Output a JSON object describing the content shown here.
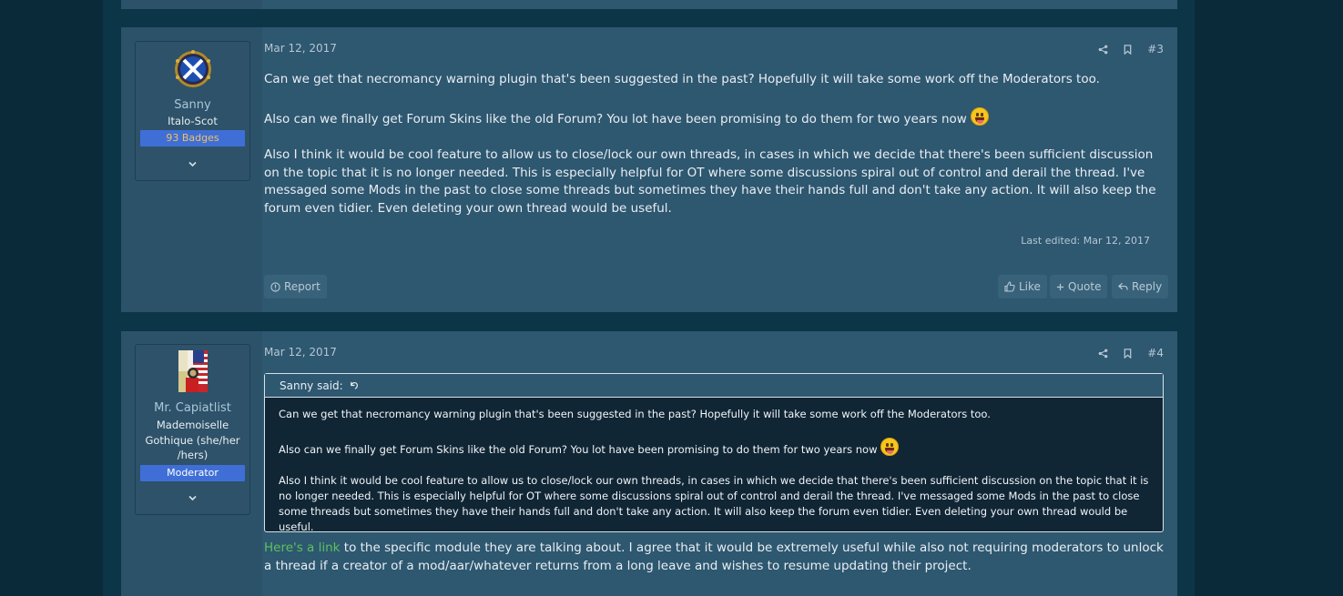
{
  "posts": [
    {
      "user": {
        "name": "Sanny",
        "title": "Italo-Scot",
        "badge": "93 Badges",
        "badge_color": "#3f6fd6",
        "badge_text_color": "#f0c060",
        "expand_icon": "chevron-down-icon",
        "avatar": "saltire-crest-avatar"
      },
      "date": "Mar 12, 2017",
      "post_number": "#3",
      "paragraphs": [
        "Can we get that necromancy warning plugin that's been suggested in the past? Hopefully it will take some work off the Moderators too.",
        "Also can we finally get Forum Skins like the old Forum? You lot have been promising to do them for two years now",
        "Also I think it would be cool feature to allow us to close/lock our own threads, in cases in which we decide that there's been sufficient discussion on the topic that it is no longer needed. This is especially helpful for OT where some discussions spiral out of control and derail the thread. I've messaged some Mods in the past to close some threads but sometimes they have their hands full and don't take any action. It will also keep the forum even tidier. Even deleting your own thread would be useful."
      ],
      "last_edited": "Last edited: Mar 12, 2017",
      "buttons": {
        "report": "Report",
        "like": "Like",
        "quote": "Quote",
        "reply": "Reply"
      }
    },
    {
      "user": {
        "name": "Mr. Capiatlist",
        "title": "Mademoiselle Gothique (she/her /hers)",
        "title_lines": [
          "Mademoiselle",
          "Gothique (she/her",
          "/hers)"
        ],
        "badge": "Moderator",
        "badge_color": "#3f6fd6",
        "badge_text_color": "#ffffff",
        "expand_icon": "chevron-down-icon",
        "avatar": "flag-collage-avatar"
      },
      "date": "Mar 12, 2017",
      "post_number": "#4",
      "quote": {
        "author": "Sanny said:",
        "paragraphs": [
          "Can we get that necromancy warning plugin that's been suggested in the past? Hopefully it will take some work off the Moderators too.",
          "Also can we finally get Forum Skins like the old Forum? You lot have been promising to do them for two years now",
          "Also I think it would be cool feature to allow us to close/lock our own threads, in cases in which we decide that there's been sufficient discussion on the topic that it is no longer needed. This is especially helpful for OT where some discussions spiral out of control and derail the thread. I've messaged some Mods in the past to close some threads but sometimes they have their hands full and don't take any action. It will also keep the forum even tidier. Even deleting your own thread would be useful."
        ]
      },
      "link_text": "Here's a link",
      "link_color": "#5cc25c",
      "body_after_link": " to the specific module they are talking about. I agree that it would be extremely useful while also not requiring moderators to unlock a thread if a creator of a mod/aar/whatever returns from a long leave and wishes to resume updating their project."
    }
  ],
  "icons": {
    "share": "share-icon",
    "bookmark": "bookmark-icon",
    "report": "report-icon",
    "like": "thumbs-up-icon",
    "quote": "plus-icon",
    "reply": "reply-icon",
    "quote_jump": "jump-back-icon",
    "emoji": "grinning-tongue-emoji"
  },
  "colors": {
    "page_bg": "#0b2a39",
    "post_bg": "#2e5770",
    "accent_link": "#5cc25c"
  }
}
